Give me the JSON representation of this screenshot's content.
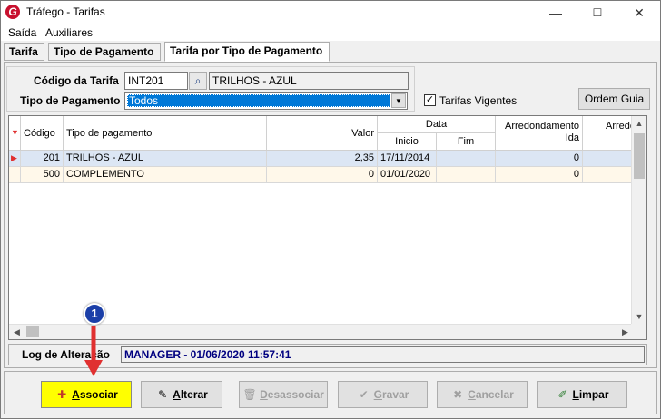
{
  "window": {
    "title": "Tráfego - Tarifas",
    "icon_letter": "G",
    "controls": [
      "—",
      "☐",
      "✕"
    ]
  },
  "menu": [
    "Saída",
    "Auxiliares"
  ],
  "tabs": [
    "Tarifa",
    "Tipo de Pagamento",
    "Tarifa por Tipo de Pagamento"
  ],
  "form": {
    "codigo_label": "Código da Tarifa",
    "codigo_value": "INT201",
    "descricao_value": "TRILHOS - AZUL",
    "tipo_label": "Tipo de Pagamento",
    "tipo_value": "Todos",
    "vigentes_label": "Tarifas Vigentes",
    "vigentes_checked": "✓",
    "ordem_button": "Ordem Guia"
  },
  "grid": {
    "headers": {
      "codigo": "Código",
      "tipo": "Tipo de pagamento",
      "valor": "Valor",
      "data": "Data",
      "inicio": "Inicio",
      "fim": "Fim",
      "arred_ida": "Arredondamento Ida",
      "arred_next": "Arredonc"
    },
    "rows": [
      {
        "codigo": "201",
        "tipo": "TRILHOS - AZUL",
        "valor": "2,35",
        "inicio": "17/11/2014",
        "fim": "",
        "arred": "0"
      },
      {
        "codigo": "500",
        "tipo": "COMPLEMENTO",
        "valor": "0",
        "inicio": "01/01/2020",
        "fim": "",
        "arred": "0"
      }
    ]
  },
  "log": {
    "label": "Log de Alteração",
    "value": "MANAGER - 01/06/2020 11:57:41"
  },
  "actions": [
    {
      "label": "Associar",
      "u": "A",
      "rest": "ssociar",
      "icon": "✚"
    },
    {
      "label": "Alterar",
      "u": "A",
      "rest": "lterar",
      "icon": "✎"
    },
    {
      "label": "Desassociar",
      "u": "D",
      "rest": "esassociar",
      "icon": "🗑"
    },
    {
      "label": "Gravar",
      "u": "G",
      "rest": "ravar",
      "icon": "✔"
    },
    {
      "label": "Cancelar",
      "u": "C",
      "rest": "ancelar",
      "icon": "✖"
    },
    {
      "label": "Limpar",
      "u": "L",
      "rest": "impar",
      "icon": "✐"
    }
  ],
  "annotation": {
    "step": "1"
  },
  "colors": {
    "highlight": "#ffff00",
    "selection": "#0078d7",
    "arrow": "#e03030",
    "badge": "#1b3fa8"
  }
}
